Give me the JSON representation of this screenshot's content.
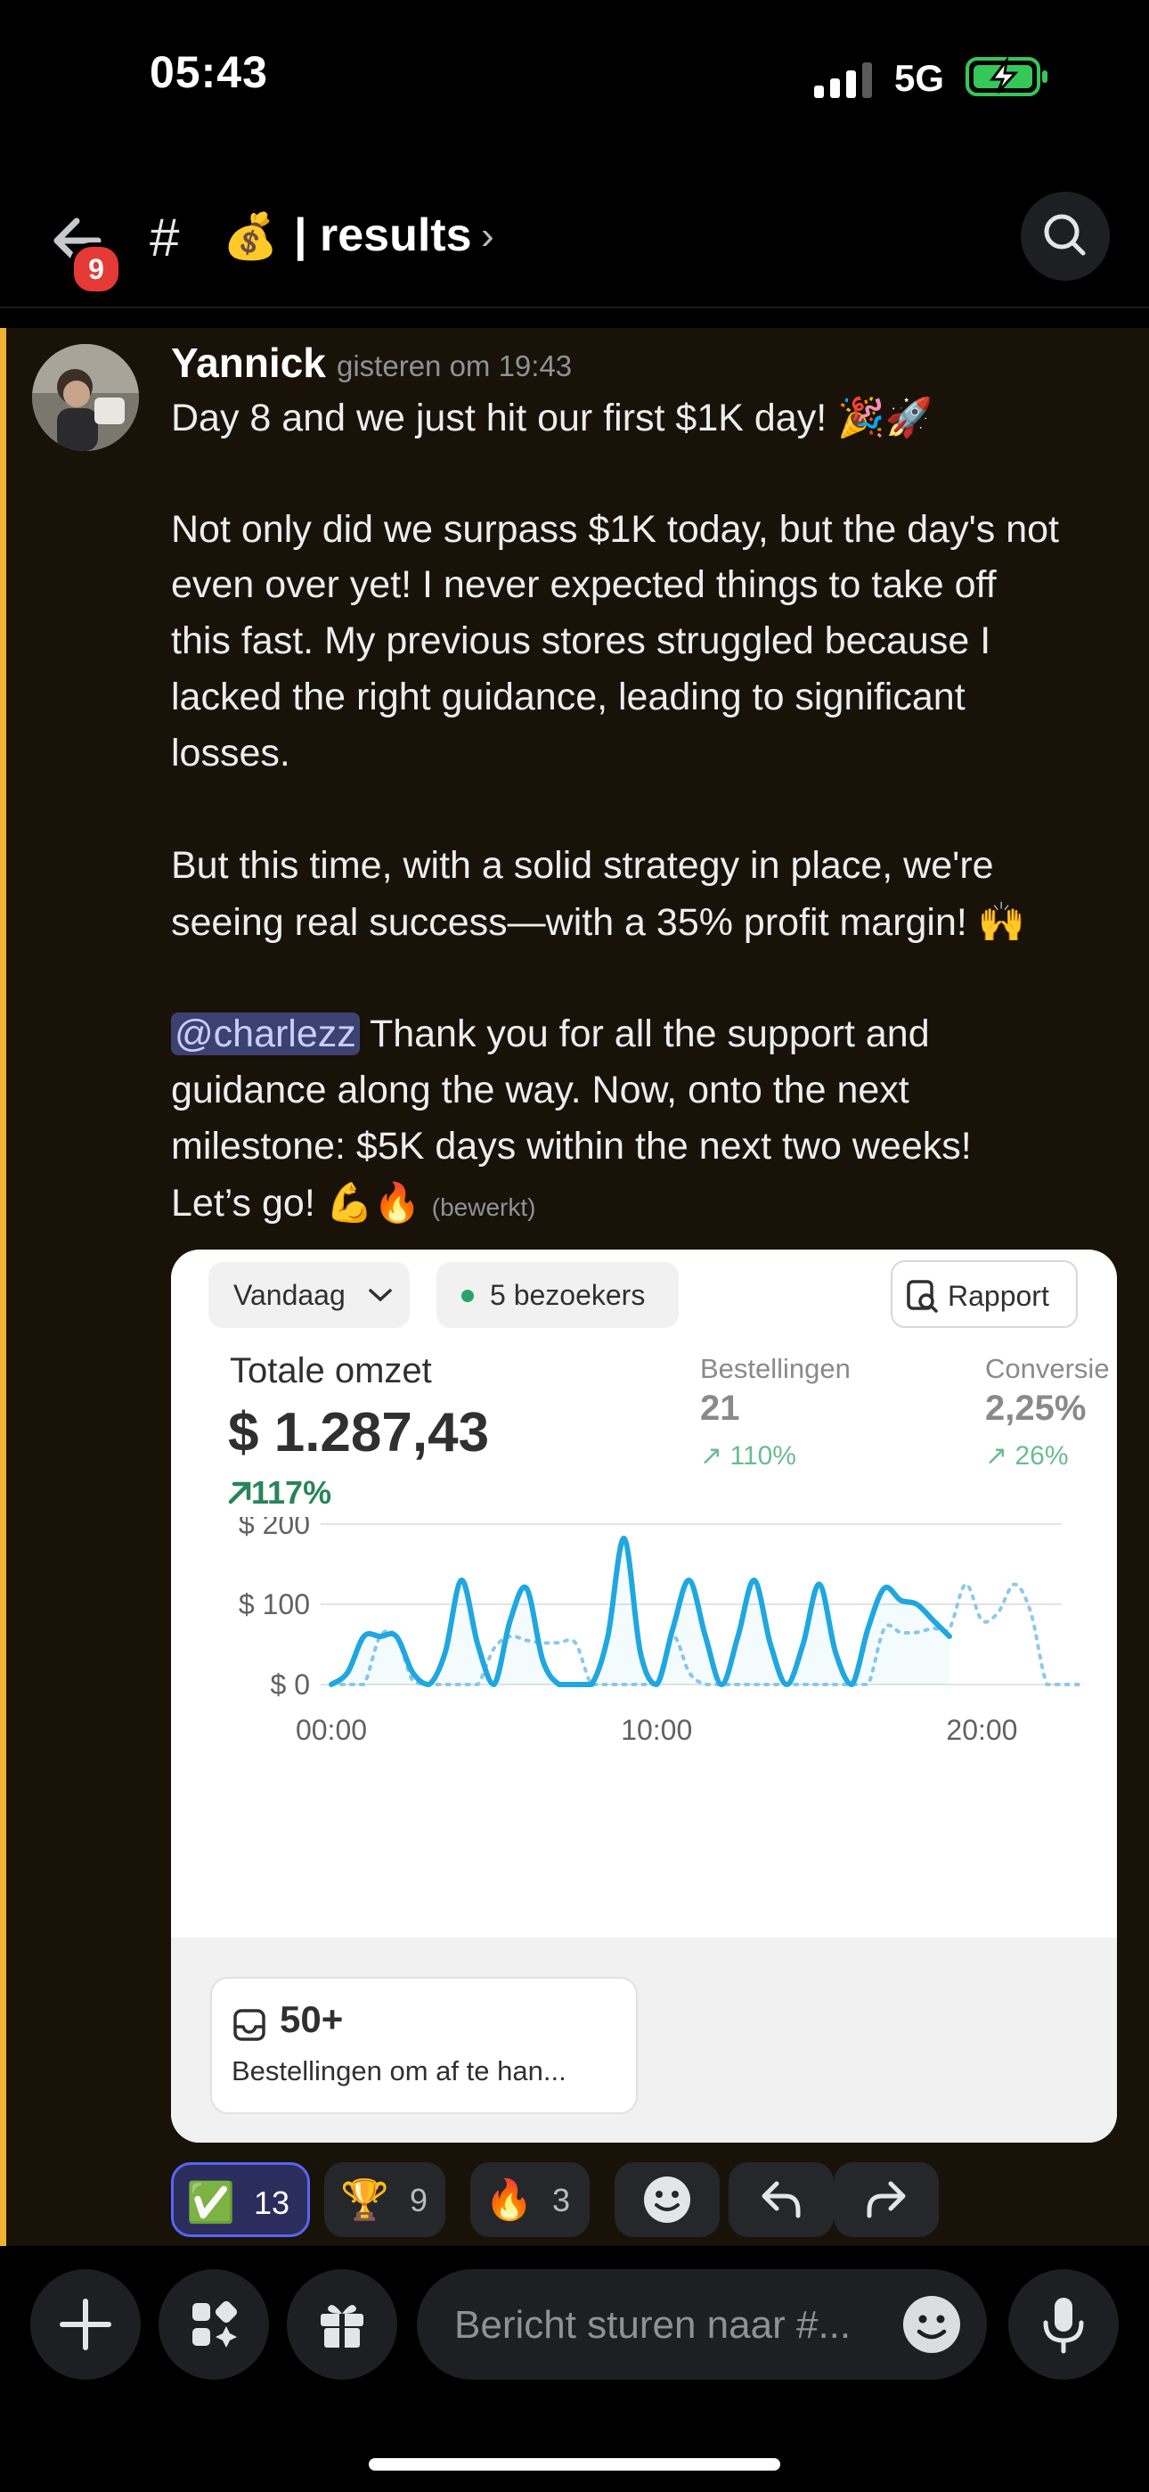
{
  "status_bar": {
    "time": "05:43",
    "network": "5G"
  },
  "header": {
    "badge_count": "9",
    "hash": "#",
    "emoji": "💰",
    "title": "| results",
    "chevron": "›"
  },
  "message": {
    "author": "Yannick",
    "timestamp": "gisteren om 19:43",
    "lines": [
      "Day 8 and we just hit our first $1K day! 🎉🚀",
      "Not only did we surpass $1K today, but the day's not",
      "even over yet! I never expected things to take off",
      "this fast. My previous stores struggled because I",
      "lacked the right guidance, leading to significant",
      "losses.",
      "But this time, with a solid strategy in place, we're",
      "seeing real success—with a 35% profit margin! 🙌",
      " Thank you for all the support and",
      "guidance along the way. Now, onto the next",
      "milestone: $5K days within the next two weeks!",
      "Let’s go! 💪🔥 "
    ],
    "mention": "@charlezz",
    "edited": "(bewerkt)"
  },
  "card": {
    "filter": "Vandaag",
    "visitors": "5 bezoekers",
    "report": "Rapport",
    "revenue_label": "Totale omzet",
    "revenue_value": "$ 1.287,43",
    "revenue_change": "117%",
    "metrics": [
      {
        "label": "Bestellingen",
        "value": "21",
        "change": "110%"
      },
      {
        "label": "Conversie",
        "value": "2,25%",
        "change": "26%"
      }
    ],
    "todo_count": "50+",
    "todo_label": "Bestellingen om af te han..."
  },
  "chart_data": {
    "type": "line",
    "title": "",
    "xlabel": "",
    "ylabel": "",
    "y_ticks": [
      "$ 200",
      "$ 100",
      "$ 0"
    ],
    "x_ticks": [
      "00:00",
      "10:00",
      "20:00"
    ],
    "ylim": [
      0,
      200
    ],
    "xlim": [
      0,
      23
    ],
    "grid": true,
    "series": [
      {
        "style": "solid",
        "color": "#1fa7e0",
        "x": [
          0,
          0.5,
          1,
          1.5,
          2,
          2.5,
          3,
          3.5,
          4,
          4.5,
          5,
          5.5,
          6,
          6.5,
          7,
          7.5,
          8,
          8.5,
          9,
          9.5,
          10,
          10.5,
          11,
          11.5,
          12,
          12.5,
          13,
          13.5,
          14,
          14.5,
          15,
          15.5,
          16,
          16.5,
          17,
          17.5,
          18,
          18.5,
          19
        ],
        "values": [
          0,
          15,
          60,
          60,
          60,
          15,
          0,
          40,
          130,
          50,
          0,
          80,
          120,
          30,
          0,
          0,
          0,
          60,
          182,
          40,
          0,
          70,
          130,
          60,
          0,
          60,
          130,
          50,
          0,
          50,
          125,
          40,
          0,
          70,
          120,
          105,
          100,
          80,
          60
        ]
      },
      {
        "style": "dotted",
        "color": "#8cc9e8",
        "x": [
          0,
          0.5,
          1,
          1.5,
          2,
          2.5,
          3,
          3.5,
          4,
          4.5,
          5,
          5.5,
          6,
          6.5,
          7,
          7.5,
          8,
          8.5,
          9,
          9.5,
          10,
          10.5,
          11,
          11.5,
          12,
          12.5,
          13,
          13.5,
          14,
          14.5,
          15,
          15.5,
          16,
          16.5,
          17,
          17.5,
          18,
          18.5,
          19,
          19.5,
          20,
          20.5,
          21,
          21.5,
          22,
          22.5,
          23
        ],
        "values": [
          0,
          0,
          0,
          60,
          60,
          5,
          0,
          0,
          0,
          0,
          45,
          60,
          55,
          52,
          52,
          52,
          0,
          0,
          0,
          0,
          0,
          60,
          15,
          0,
          0,
          0,
          0,
          0,
          0,
          0,
          0,
          0,
          0,
          0,
          70,
          65,
          65,
          70,
          70,
          125,
          80,
          90,
          125,
          90,
          0,
          0,
          0
        ]
      }
    ]
  },
  "reactions": [
    {
      "emoji": "✅",
      "count": "13",
      "selected": true
    },
    {
      "emoji": "🏆",
      "count": "9"
    },
    {
      "emoji": "🔥",
      "count": "3"
    }
  ],
  "composer": {
    "placeholder": "Bericht sturen naar #..."
  },
  "colors": {
    "accent": "#5865f2",
    "highlight_bar": "#f0b232",
    "chart_line": "#1fa7e0",
    "positive": "#29845a"
  }
}
